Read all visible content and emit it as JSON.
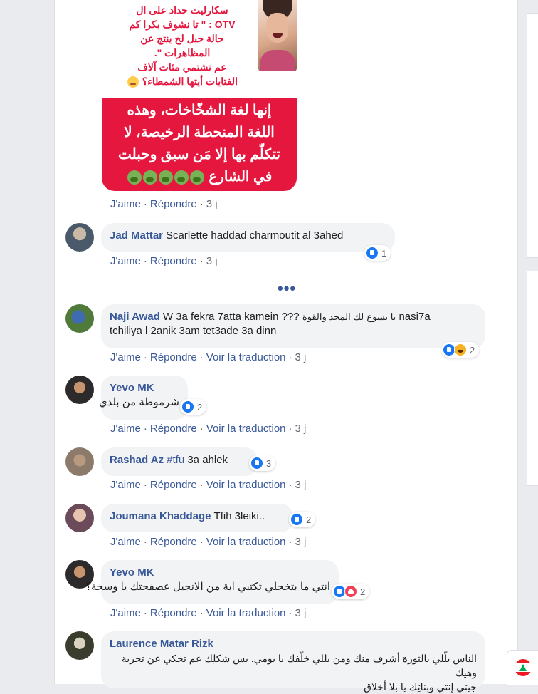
{
  "post": {
    "image_top_lines": [
      "سكارليت حداد على ال",
      "OTV : \" تا نشوف بكرا كم",
      "حالة حبل لح ينتج عن",
      "المظاهرات \".",
      "عم تشتمي مئات آلاف",
      "الفتايات أيتها الشمطاء؟"
    ],
    "image_bottom_lines": [
      "إنها لغة الشخّاخات، وهذه",
      "اللغة المنحطة الرخيصة، لا",
      "تتكلّم بها إلا مَن سبق وحبلت",
      "في الشارع"
    ],
    "actions": {
      "like": "J'aime",
      "reply": "Répondre",
      "time": "3 j"
    }
  },
  "labels": {
    "like": "J'aime",
    "reply": "Répondre",
    "translate": "Voir la traduction",
    "dot": "·",
    "more": "•••"
  },
  "comments": [
    {
      "author": "Jad Mattar",
      "text": "Scarlette haddad charmoutit al 3ahed",
      "reactions": [
        "like"
      ],
      "reaction_count": "1",
      "time": "3 j",
      "has_translate": false
    },
    {
      "author": "Naji Awad",
      "text_line1_a": "W 3a fekra 7atta kamein ???",
      "text_line1_b": "يا يسوع",
      "text_line1_c": "لك المجد والقوة",
      "text_line1_d": "nasi7a",
      "text_line2": "tchiliya l 2anik 3am tet3ade 3a dinn",
      "reactions": [
        "like",
        "haha"
      ],
      "reaction_count": "2",
      "time": "3 j",
      "has_translate": true
    },
    {
      "author": "Yevo MK",
      "text": "شرموطة من بلدي",
      "reactions": [
        "like"
      ],
      "reaction_count": "2",
      "time": "3 j",
      "has_translate": true
    },
    {
      "author": "Rashad Az",
      "hashtag": "#tfu",
      "text": "3a ahlek",
      "reactions": [
        "like"
      ],
      "reaction_count": "3",
      "time": "3 j",
      "has_translate": true
    },
    {
      "author": "Joumana Khaddage",
      "text": "Tfih 3leiki..",
      "reactions": [
        "like"
      ],
      "reaction_count": "2",
      "time": "3 j",
      "has_translate": true
    },
    {
      "author": "Yevo MK",
      "text": "انتي ما بتخجلي تكتبي اية من الانجيل عصفحتك يا وسخة؟",
      "reactions": [
        "like",
        "love"
      ],
      "reaction_count": "2",
      "time": "3 j",
      "has_translate": true
    },
    {
      "author": "Laurence Matar Rizk",
      "text_line1": "الناس يلّلي بالثورة أشرف منك ومن يللي خلّفك يا بومي. بس شكلِك عم تحكي عن تجربة وهيك",
      "text_line2": "جيتي إنتي وبناتِك يا بلا أخلاق",
      "reactions": [],
      "reaction_count": "",
      "time": "",
      "has_translate": false
    }
  ],
  "colors": {
    "link": "#385898",
    "bubble": "#f2f3f5",
    "post_red": "#e5173f",
    "muted": "#606770"
  }
}
